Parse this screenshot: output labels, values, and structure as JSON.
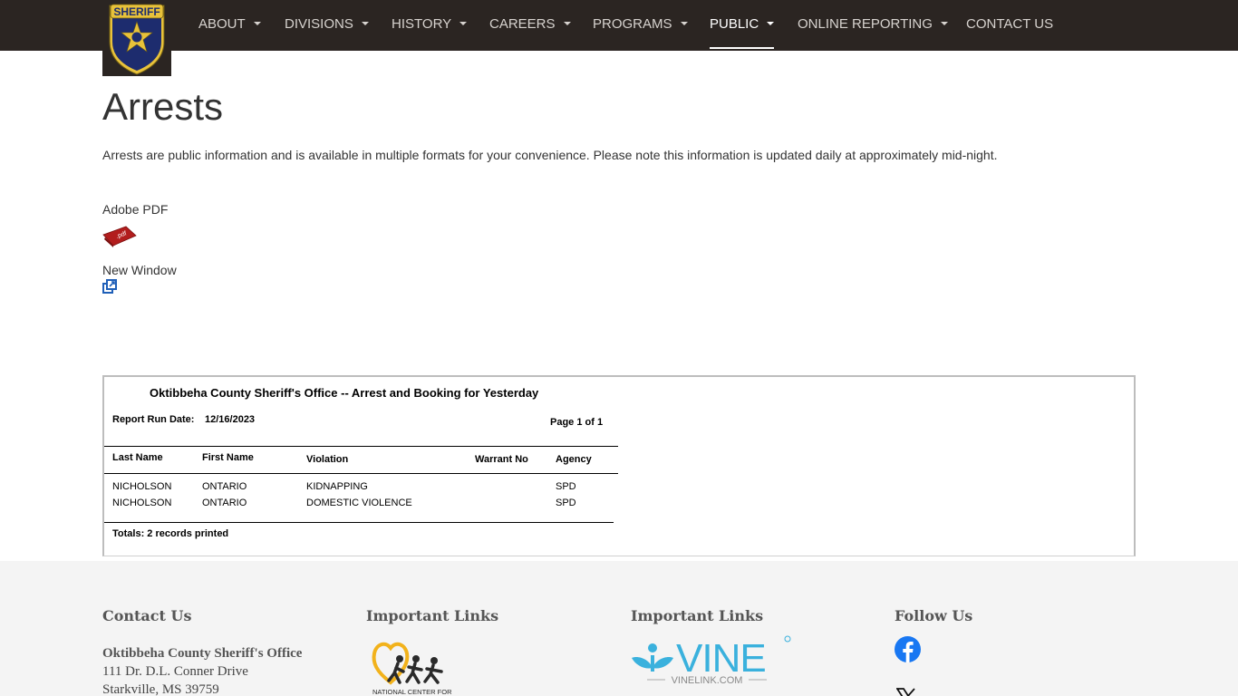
{
  "nav": {
    "logo_text": "SHERIFF",
    "items": [
      {
        "label": "ABOUT",
        "dropdown": true
      },
      {
        "label": "DIVISIONS",
        "dropdown": true
      },
      {
        "label": "HISTORY",
        "dropdown": true
      },
      {
        "label": "CAREERS",
        "dropdown": true
      },
      {
        "label": "PROGRAMS",
        "dropdown": true
      },
      {
        "label": "PUBLIC",
        "dropdown": true,
        "active": true
      },
      {
        "label": "ONLINE REPORTING",
        "dropdown": true
      },
      {
        "label": "CONTACT US",
        "dropdown": false
      }
    ]
  },
  "page": {
    "title": "Arrests",
    "intro": "Arrests are public information and is available in multiple formats for your convenience. Please note this information is updated daily at approximately mid-night.",
    "formats": [
      {
        "label": "Adobe PDF",
        "icon": "pdf-icon"
      },
      {
        "label": "New Window",
        "icon": "new-window-icon"
      }
    ]
  },
  "report": {
    "title": "Oktibbeha County Sheriff's Office  -- Arrest and Booking for Yesterday",
    "run_date_label": "Report Run Date:",
    "run_date": "12/16/2023",
    "page_info": "Page 1 of 1",
    "columns": [
      "Last Name",
      "First Name",
      "Violation",
      "Warrant No",
      "Agency"
    ],
    "rows": [
      [
        "NICHOLSON",
        "ONTARIO",
        "KIDNAPPING",
        "",
        "SPD"
      ],
      [
        "NICHOLSON",
        "ONTARIO",
        "DOMESTIC VIOLENCE",
        "",
        "SPD"
      ]
    ],
    "totals": "Totals: 2 records printed"
  },
  "footer": {
    "contact_heading": "Contact Us",
    "office_name": "Oktibbeha County Sheriff's Office",
    "address1": "111 Dr. D.L. Conner Drive",
    "address2": "Starkville, MS 39759",
    "links1_heading": "Important Links",
    "ncmec_text": "NATIONAL CENTER FOR",
    "links2_heading": "Important Links",
    "vine_text": "VINE",
    "vine_sub": "VINELINK.COM",
    "follow_heading": "Follow Us"
  },
  "colors": {
    "nav_bg": "#2b2522",
    "footer_bg": "#f4f4f4",
    "pdf_red": "#b21d1d",
    "link_blue": "#1f5fb8",
    "facebook_blue": "#1877f2",
    "vine_blue": "#3ab1dd",
    "ncmec_gold": "#f2b21b"
  }
}
